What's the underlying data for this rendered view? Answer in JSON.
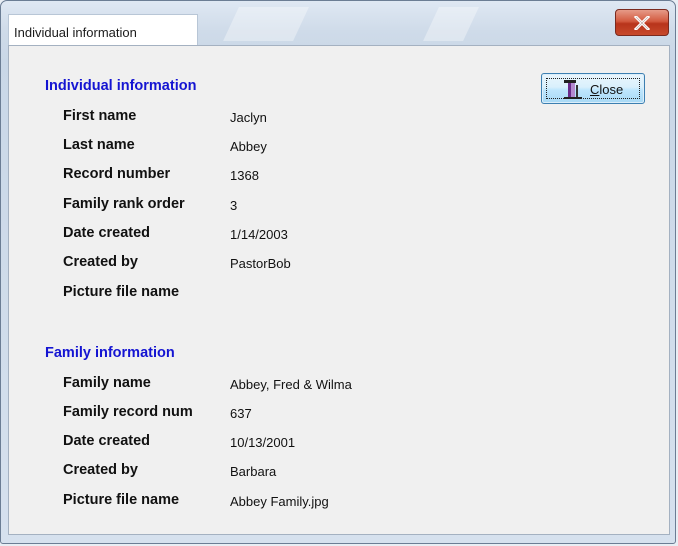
{
  "window": {
    "title": "Individual information"
  },
  "toolbar": {
    "close_label_first": "C",
    "close_label_rest": "lose"
  },
  "individual": {
    "heading": "Individual information",
    "rows": [
      {
        "label": "First name",
        "value": "Jaclyn"
      },
      {
        "label": "Last name",
        "value": "Abbey"
      },
      {
        "label": "Record number",
        "value": "1368"
      },
      {
        "label": "Family rank order",
        "value": "3"
      },
      {
        "label": "Date created",
        "value": "1/14/2003"
      },
      {
        "label": "Created by",
        "value": "PastorBob"
      },
      {
        "label": "Picture file name",
        "value": ""
      }
    ]
  },
  "family": {
    "heading": "Family information",
    "rows": [
      {
        "label": "Family name",
        "value": "Abbey, Fred & Wilma"
      },
      {
        "label": "Family record num",
        "value": "637"
      },
      {
        "label": "Date created",
        "value": "10/13/2001"
      },
      {
        "label": "Created by",
        "value": "Barbara"
      },
      {
        "label": "Picture file name",
        "value": "Abbey Family.jpg"
      }
    ]
  },
  "colors": {
    "heading": "#1414d2",
    "close_x": "#c7492b",
    "button_border": "#3c7fb1"
  },
  "icons": {
    "window_close": "close-icon",
    "button_icon": "exit-door-icon"
  }
}
